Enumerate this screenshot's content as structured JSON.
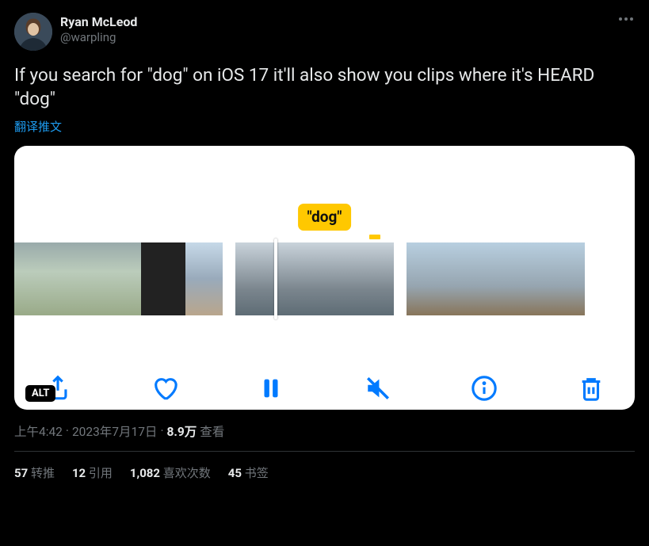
{
  "user": {
    "display_name": "Ryan McLeod",
    "handle": "@warpling"
  },
  "tweet_text": "If you search for \"dog\" on iOS 17 it'll also show you clips where it's HEARD \"dog\"",
  "translate_label": "翻译推文",
  "media": {
    "caption_pill": "\"dog\"",
    "alt_badge": "ALT"
  },
  "meta": {
    "time": "上午4:42",
    "dot1": " · ",
    "date": "2023年7月17日",
    "dot2": " · ",
    "views_count": "8.9万",
    "views_label": " 查看"
  },
  "stats": {
    "retweets_count": "57",
    "retweets_label": " 转推",
    "quotes_count": "12",
    "quotes_label": " 引用",
    "likes_count": "1,082",
    "likes_label": " 喜欢次数",
    "bookmarks_count": "45",
    "bookmarks_label": " 书签"
  }
}
